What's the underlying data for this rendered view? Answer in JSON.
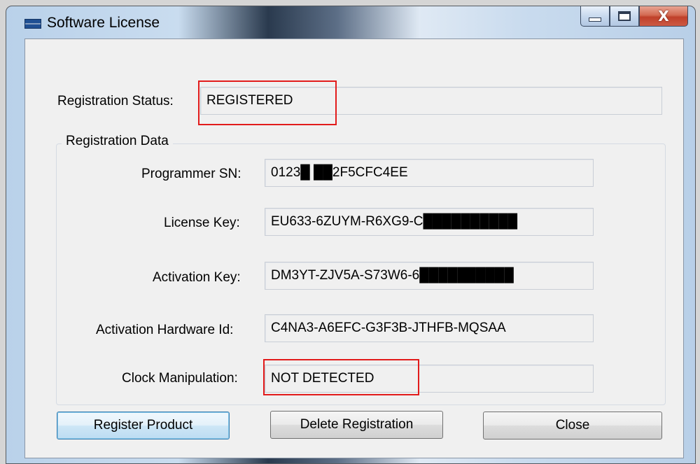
{
  "window": {
    "title": "Software License",
    "icon": "license-app-icon",
    "controls": {
      "minimize": "minimize-icon",
      "maximize": "maximize-icon",
      "close_glyph": "X"
    }
  },
  "status": {
    "label": "Registration Status:",
    "value": "REGISTERED"
  },
  "registration_data": {
    "legend": "Registration Data",
    "programmer_sn": {
      "label": "Programmer SN:",
      "value": "0123█ ██2F5CFC4EE"
    },
    "license_key": {
      "label": "License Key:",
      "value": "EU633-6ZUYM-R6XG9-C██████████"
    },
    "activation_key": {
      "label": "Activation Key:",
      "value": "DM3YT-ZJV5A-S73W6-6██████████"
    },
    "activation_hardware_id": {
      "label": "Activation Hardware Id:",
      "value": "C4NA3-A6EFC-G3F3B-JTHFB-MQSAA"
    },
    "clock_manipulation": {
      "label": "Clock Manipulation:",
      "value": "NOT DETECTED"
    }
  },
  "buttons": {
    "register": "Register Product",
    "delete": "Delete Registration",
    "close": "Close"
  },
  "colors": {
    "highlight": "#e21b1b",
    "dialog_bg": "#f0f0f0",
    "default_button_border": "#3c7fb1"
  }
}
